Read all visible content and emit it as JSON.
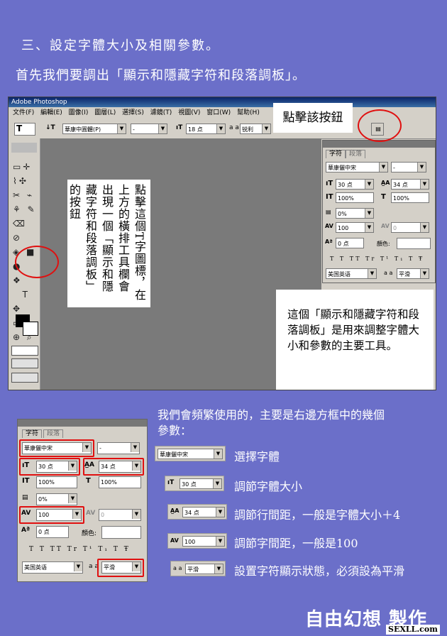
{
  "heading": "三、設定字體大小及相關參數。",
  "subheading": "首先我們要調出「顯示和隱藏字符和段落調板」。",
  "window": {
    "title": "Adobe Photoshop",
    "menu": [
      "文件(F)",
      "編輯(E)",
      "圖像(I)",
      "圖層(L)",
      "選擇(S)",
      "濾鏡(T)",
      "視圖(V)",
      "窗口(W)",
      "幫助(H)"
    ]
  },
  "options": {
    "tool": "T",
    "orient": "↓T",
    "font_family": "華康中圓體(P)",
    "font_style": "-",
    "size": "18 点",
    "aa_label": "a a",
    "aa": "锐利"
  },
  "callout_click": "點擊該按鈕",
  "callout_vertical": "點擊這個T字圖標，在上方的橫排工具欄會出現一個「顯示和隱藏字符和段落調板」的按鈕",
  "callout_tool": "這個「顯示和隱藏字符和段落調板」是用來調整字體大小和參數的主要工具。",
  "panel": {
    "tab_char": "字符",
    "tab_para": "段落",
    "font": "華康儷中宋",
    "style": "-",
    "size": "30 点",
    "leading": "34 点",
    "vscale": "100%",
    "hscale": "100%",
    "baseline_shift_pct": "0%",
    "tracking": "100",
    "kerning": "0",
    "baseline": "0 点",
    "color_label": "顏色:",
    "format_buttons": "T T TT Tr T¹ T₁ T Ŧ",
    "language": "美国英语",
    "aa_label": "a a",
    "aa": "平滑"
  },
  "intro_text_1": "我們會頻繁使用的，主要是右邊方框中的幾個",
  "intro_text_2": "參數：",
  "legend": [
    {
      "value": "華康儷中宋",
      "desc": "選擇字體"
    },
    {
      "value": "30 点",
      "desc": "調節字體大小"
    },
    {
      "value": "34 点",
      "desc": "調節行間距，一般是字體大小＋4"
    },
    {
      "value": "100",
      "desc": "調節字間距，一般是100"
    },
    {
      "value": "平滑",
      "desc": "設置字符顯示狀態，必須設為平滑"
    }
  ],
  "footer_credit": "自由幻想 製作",
  "footer_site": "SEXLL.com"
}
